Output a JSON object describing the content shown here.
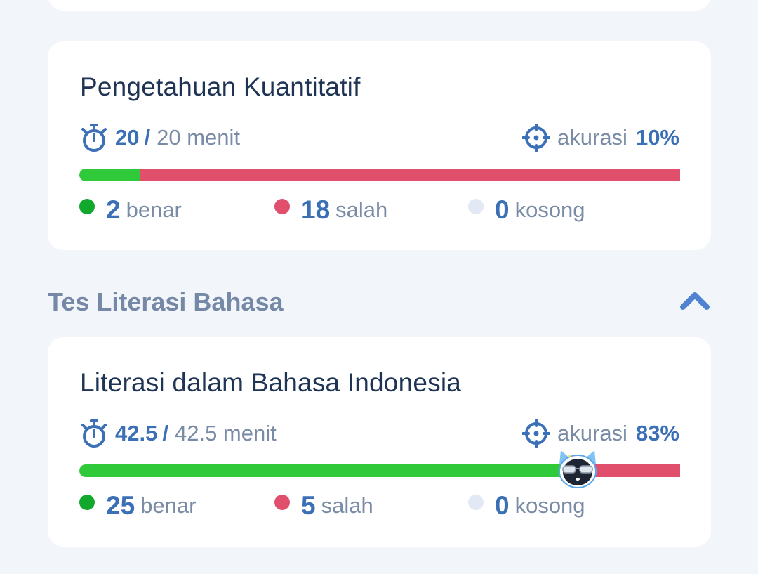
{
  "cards": [
    {
      "title": "Pengetahuan Kuantitatif",
      "time_done": "20",
      "time_slash": "/",
      "time_total": "20 menit",
      "accuracy_label": "akurasi",
      "accuracy_value": "10%",
      "progress": {
        "correct_fraction": 0.1,
        "wrong_fraction": 0.9
      },
      "correct_count": "2",
      "correct_label": "benar",
      "wrong_count": "18",
      "wrong_label": "salah",
      "empty_count": "0",
      "empty_label": "kosong"
    },
    {
      "title": "Literasi dalam Bahasa Indonesia",
      "time_done": "42.5",
      "time_slash": "/",
      "time_total": "42.5 menit",
      "accuracy_label": "akurasi",
      "accuracy_value": "83%",
      "progress": {
        "correct_fraction": 0.83,
        "wrong_fraction": 0.17
      },
      "correct_count": "25",
      "correct_label": "benar",
      "wrong_count": "5",
      "wrong_label": "salah",
      "empty_count": "0",
      "empty_label": "kosong"
    }
  ],
  "section": {
    "title": "Tes Literasi Bahasa",
    "toggle_icon": "chevron-up-icon"
  },
  "colors": {
    "correct": "#2fc93a",
    "wrong": "#e0506c",
    "empty": "#e2e9f4",
    "accent": "#3b6fb6",
    "muted": "#7a8ba6"
  }
}
